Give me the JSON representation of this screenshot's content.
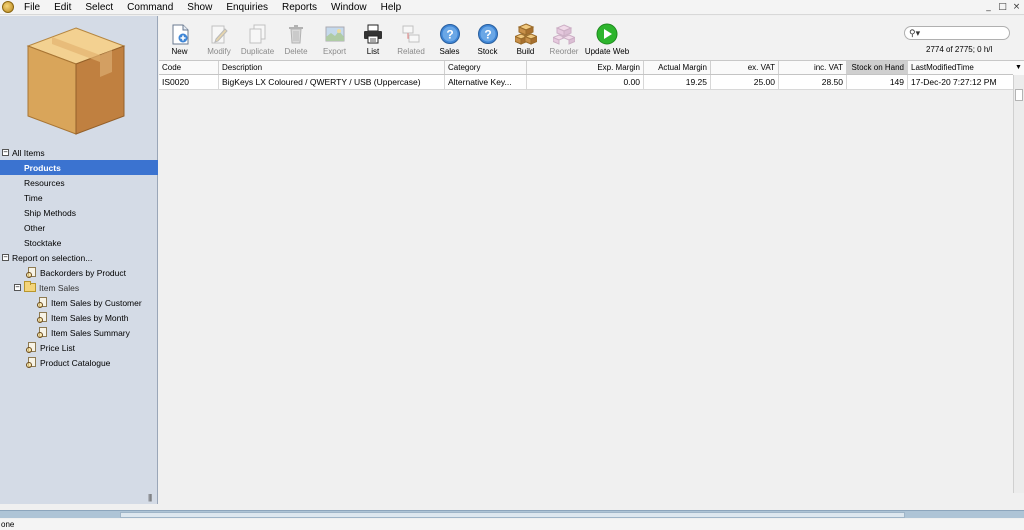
{
  "menu": [
    "File",
    "Edit",
    "Select",
    "Command",
    "Show",
    "Enquiries",
    "Reports",
    "Window",
    "Help"
  ],
  "window_controls": [
    "_",
    "□",
    "×"
  ],
  "sidebar": {
    "tree": [
      {
        "label": "All Items",
        "level": 0,
        "expander": "-"
      },
      {
        "label": "Products",
        "level": 1,
        "selected": true
      },
      {
        "label": "Resources",
        "level": 1
      },
      {
        "label": "Time",
        "level": 1
      },
      {
        "label": "Ship Methods",
        "level": 1
      },
      {
        "label": "Other",
        "level": 1
      },
      {
        "label": "Stocktake",
        "level": 1
      },
      {
        "label": "Report on selection...",
        "level": 0,
        "expander": "-"
      },
      {
        "label": "Backorders by Product",
        "level": 1,
        "icon": "report-icon"
      },
      {
        "label": "Item Sales",
        "level": 1,
        "icon": "folder-icon",
        "expander": "-"
      },
      {
        "label": "Item Sales by Customer",
        "level": 2,
        "icon": "report-icon"
      },
      {
        "label": "Item Sales by Month",
        "level": 2,
        "icon": "report-icon"
      },
      {
        "label": "Item Sales Summary",
        "level": 2,
        "icon": "report-icon"
      },
      {
        "label": "Price List",
        "level": 1,
        "icon": "report-icon"
      },
      {
        "label": "Product Catalogue",
        "level": 1,
        "icon": "report-icon"
      }
    ],
    "grip": "|||"
  },
  "toolbar": [
    {
      "label": "New",
      "icon": "new-document-icon",
      "enabled": true
    },
    {
      "label": "Modify",
      "icon": "modify-icon",
      "enabled": false
    },
    {
      "label": "Duplicate",
      "icon": "duplicate-icon",
      "enabled": false
    },
    {
      "label": "Delete",
      "icon": "trash-icon",
      "enabled": false
    },
    {
      "label": "Export",
      "icon": "export-icon",
      "enabled": false
    },
    {
      "label": "List",
      "icon": "printer-icon",
      "enabled": true
    },
    {
      "label": "Related",
      "icon": "related-icon",
      "enabled": false
    },
    {
      "label": "Sales",
      "icon": "help-icon",
      "enabled": true
    },
    {
      "label": "Stock",
      "icon": "help-icon",
      "enabled": true
    },
    {
      "label": "Build",
      "icon": "build-icon",
      "enabled": true
    },
    {
      "label": "Reorder",
      "icon": "reorder-icon",
      "enabled": false
    },
    {
      "label": "Update Web",
      "icon": "play-icon",
      "enabled": true
    }
  ],
  "search": {
    "icon": "search-icon",
    "glyph": "⚲▾",
    "value": ""
  },
  "record_count": "2774 of 2775; 0 h/l",
  "grid": {
    "columns": [
      "Code",
      "Description",
      "Category",
      "Exp. Margin",
      "Actual Margin",
      "ex. VAT",
      "inc. VAT",
      "Stock on Hand",
      "LastModifiedTime"
    ],
    "sorted_column": "Stock on Hand",
    "rows": [
      [
        "IS0020",
        "BigKeys LX Coloured / QWERTY / USB (Uppercase)",
        "Alternative Key...",
        "0.00",
        "19.25",
        "25.00",
        "28.50",
        "149",
        "17-Dec-20 7:27:12 PM"
      ]
    ],
    "header_menu": "▼"
  },
  "status": "one",
  "colors": {
    "selection": "#3b73d0",
    "sidebar": "#d4dbe6",
    "accent_green": "#2db52d",
    "help_blue": "#3f86d6"
  }
}
